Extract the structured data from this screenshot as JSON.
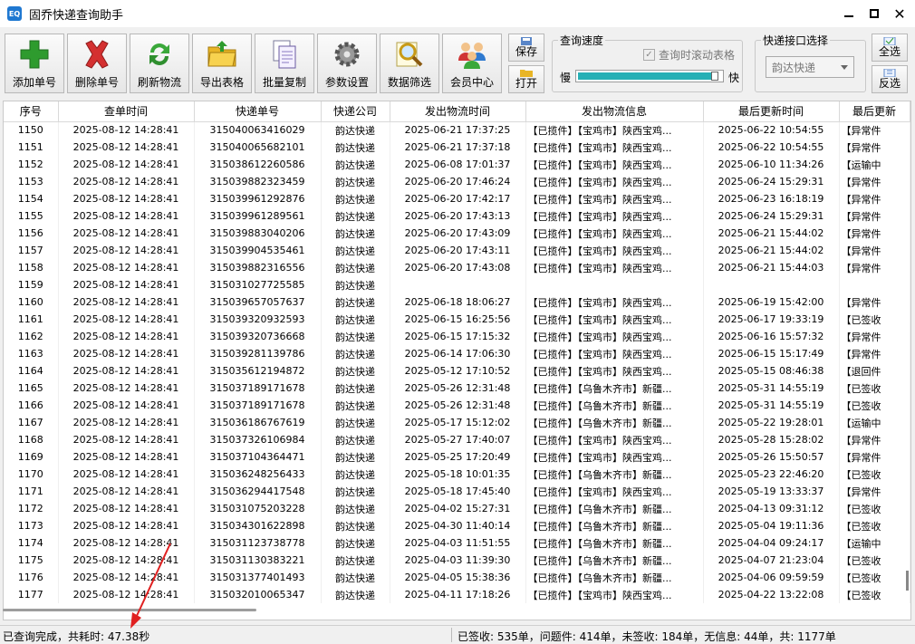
{
  "app": {
    "title": "固乔快递查询助手",
    "icon_text": "EQ"
  },
  "toolbar": {
    "buttons": [
      {
        "id": "add",
        "label": "添加单号",
        "icon": "plus-icon"
      },
      {
        "id": "delete",
        "label": "删除单号",
        "icon": "delete-x-icon"
      },
      {
        "id": "refresh",
        "label": "刷新物流",
        "icon": "refresh-icon"
      },
      {
        "id": "export",
        "label": "导出表格",
        "icon": "folder-export-icon"
      },
      {
        "id": "copy",
        "label": "批量复制",
        "icon": "copy-pages-icon"
      },
      {
        "id": "settings",
        "label": "参数设置",
        "icon": "gear-icon"
      },
      {
        "id": "filter",
        "label": "数据筛选",
        "icon": "magnifier-icon"
      },
      {
        "id": "member",
        "label": "会员中心",
        "icon": "users-icon"
      }
    ],
    "save_label": "保存",
    "open_label": "打开",
    "select_all_label": "全选",
    "invert_label": "反选"
  },
  "speed": {
    "group_label": "查询速度",
    "scroll_checkbox_label": "查询时滚动表格",
    "scroll_checked": true,
    "slow_label": "慢",
    "fast_label": "快",
    "level": 0.98
  },
  "api": {
    "group_label": "快递接口选择",
    "selected": "韵达快递"
  },
  "table": {
    "columns": [
      "序号",
      "查单时间",
      "快递单号",
      "快递公司",
      "发出物流时间",
      "发出物流信息",
      "最后更新时间",
      "最后更新"
    ],
    "rows": [
      [
        "1150",
        "2025-08-12 14:28:41",
        "315040063416029",
        "韵达快递",
        "2025-06-21 17:37:25",
        "【已揽件】【宝鸡市】陕西宝鸡...",
        "2025-06-22 10:54:55",
        "【异常件"
      ],
      [
        "1151",
        "2025-08-12 14:28:41",
        "315040065682101",
        "韵达快递",
        "2025-06-21 17:37:18",
        "【已揽件】【宝鸡市】陕西宝鸡...",
        "2025-06-22 10:54:55",
        "【异常件"
      ],
      [
        "1152",
        "2025-08-12 14:28:41",
        "315038612260586",
        "韵达快递",
        "2025-06-08 17:01:37",
        "【已揽件】【宝鸡市】陕西宝鸡...",
        "2025-06-10 11:34:26",
        "【运输中"
      ],
      [
        "1153",
        "2025-08-12 14:28:41",
        "315039882323459",
        "韵达快递",
        "2025-06-20 17:46:24",
        "【已揽件】【宝鸡市】陕西宝鸡...",
        "2025-06-24 15:29:31",
        "【异常件"
      ],
      [
        "1154",
        "2025-08-12 14:28:41",
        "315039961292876",
        "韵达快递",
        "2025-06-20 17:42:17",
        "【已揽件】【宝鸡市】陕西宝鸡...",
        "2025-06-23 16:18:19",
        "【异常件"
      ],
      [
        "1155",
        "2025-08-12 14:28:41",
        "315039961289561",
        "韵达快递",
        "2025-06-20 17:43:13",
        "【已揽件】【宝鸡市】陕西宝鸡...",
        "2025-06-24 15:29:31",
        "【异常件"
      ],
      [
        "1156",
        "2025-08-12 14:28:41",
        "315039883040206",
        "韵达快递",
        "2025-06-20 17:43:09",
        "【已揽件】【宝鸡市】陕西宝鸡...",
        "2025-06-21 15:44:02",
        "【异常件"
      ],
      [
        "1157",
        "2025-08-12 14:28:41",
        "315039904535461",
        "韵达快递",
        "2025-06-20 17:43:11",
        "【已揽件】【宝鸡市】陕西宝鸡...",
        "2025-06-21 15:44:02",
        "【异常件"
      ],
      [
        "1158",
        "2025-08-12 14:28:41",
        "315039882316556",
        "韵达快递",
        "2025-06-20 17:43:08",
        "【已揽件】【宝鸡市】陕西宝鸡...",
        "2025-06-21 15:44:03",
        "【异常件"
      ],
      [
        "1159",
        "2025-08-12 14:28:41",
        "315031027725585",
        "韵达快递",
        "",
        "",
        "",
        ""
      ],
      [
        "1160",
        "2025-08-12 14:28:41",
        "315039657057637",
        "韵达快递",
        "2025-06-18 18:06:27",
        "【已揽件】【宝鸡市】陕西宝鸡...",
        "2025-06-19 15:42:00",
        "【异常件"
      ],
      [
        "1161",
        "2025-08-12 14:28:41",
        "315039320932593",
        "韵达快递",
        "2025-06-15 16:25:56",
        "【已揽件】【宝鸡市】陕西宝鸡...",
        "2025-06-17 19:33:19",
        "【已签收"
      ],
      [
        "1162",
        "2025-08-12 14:28:41",
        "315039320736668",
        "韵达快递",
        "2025-06-15 17:15:32",
        "【已揽件】【宝鸡市】陕西宝鸡...",
        "2025-06-16 15:57:32",
        "【异常件"
      ],
      [
        "1163",
        "2025-08-12 14:28:41",
        "315039281139786",
        "韵达快递",
        "2025-06-14 17:06:30",
        "【已揽件】【宝鸡市】陕西宝鸡...",
        "2025-06-15 15:17:49",
        "【异常件"
      ],
      [
        "1164",
        "2025-08-12 14:28:41",
        "315035612194872",
        "韵达快递",
        "2025-05-12 17:10:52",
        "【已揽件】【宝鸡市】陕西宝鸡...",
        "2025-05-15 08:46:38",
        "【退回件"
      ],
      [
        "1165",
        "2025-08-12 14:28:41",
        "315037189171678",
        "韵达快递",
        "2025-05-26 12:31:48",
        "【已揽件】【乌鲁木齐市】新疆...",
        "2025-05-31 14:55:19",
        "【已签收"
      ],
      [
        "1166",
        "2025-08-12 14:28:41",
        "315037189171678",
        "韵达快递",
        "2025-05-26 12:31:48",
        "【已揽件】【乌鲁木齐市】新疆...",
        "2025-05-31 14:55:19",
        "【已签收"
      ],
      [
        "1167",
        "2025-08-12 14:28:41",
        "315036186767619",
        "韵达快递",
        "2025-05-17 15:12:02",
        "【已揽件】【乌鲁木齐市】新疆...",
        "2025-05-22 19:28:01",
        "【运输中"
      ],
      [
        "1168",
        "2025-08-12 14:28:41",
        "315037326106984",
        "韵达快递",
        "2025-05-27 17:40:07",
        "【已揽件】【宝鸡市】陕西宝鸡...",
        "2025-05-28 15:28:02",
        "【异常件"
      ],
      [
        "1169",
        "2025-08-12 14:28:41",
        "315037104364471",
        "韵达快递",
        "2025-05-25 17:20:49",
        "【已揽件】【宝鸡市】陕西宝鸡...",
        "2025-05-26 15:50:57",
        "【异常件"
      ],
      [
        "1170",
        "2025-08-12 14:28:41",
        "315036248256433",
        "韵达快递",
        "2025-05-18 10:01:35",
        "【已揽件】【乌鲁木齐市】新疆...",
        "2025-05-23 22:46:20",
        "【已签收"
      ],
      [
        "1171",
        "2025-08-12 14:28:41",
        "315036294417548",
        "韵达快递",
        "2025-05-18 17:45:40",
        "【已揽件】【宝鸡市】陕西宝鸡...",
        "2025-05-19 13:33:37",
        "【异常件"
      ],
      [
        "1172",
        "2025-08-12 14:28:41",
        "315031075203228",
        "韵达快递",
        "2025-04-02 15:27:31",
        "【已揽件】【乌鲁木齐市】新疆...",
        "2025-04-13 09:31:12",
        "【已签收"
      ],
      [
        "1173",
        "2025-08-12 14:28:41",
        "315034301622898",
        "韵达快递",
        "2025-04-30 11:40:14",
        "【已揽件】【乌鲁木齐市】新疆...",
        "2025-05-04 19:11:36",
        "【已签收"
      ],
      [
        "1174",
        "2025-08-12 14:28:41",
        "315031123738778",
        "韵达快递",
        "2025-04-03 11:51:55",
        "【已揽件】【乌鲁木齐市】新疆...",
        "2025-04-04 09:24:17",
        "【运输中"
      ],
      [
        "1175",
        "2025-08-12 14:28:41",
        "315031130383221",
        "韵达快递",
        "2025-04-03 11:39:30",
        "【已揽件】【乌鲁木齐市】新疆...",
        "2025-04-07 21:23:04",
        "【已签收"
      ],
      [
        "1176",
        "2025-08-12 14:28:41",
        "315031377401493",
        "韵达快递",
        "2025-04-05 15:38:36",
        "【已揽件】【乌鲁木齐市】新疆...",
        "2025-04-06 09:59:59",
        "【已签收"
      ],
      [
        "1177",
        "2025-08-12 14:28:41",
        "315032010065347",
        "韵达快递",
        "2025-04-11 17:18:26",
        "【已揽件】【宝鸡市】陕西宝鸡...",
        "2025-04-22 13:22:08",
        "【已签收"
      ]
    ]
  },
  "status": {
    "left": "已查询完成，共耗时: 47.38秒",
    "right": "已签收: 535单，问题件: 414单，未签收: 184单，无信息: 44单，共: 1177单"
  }
}
